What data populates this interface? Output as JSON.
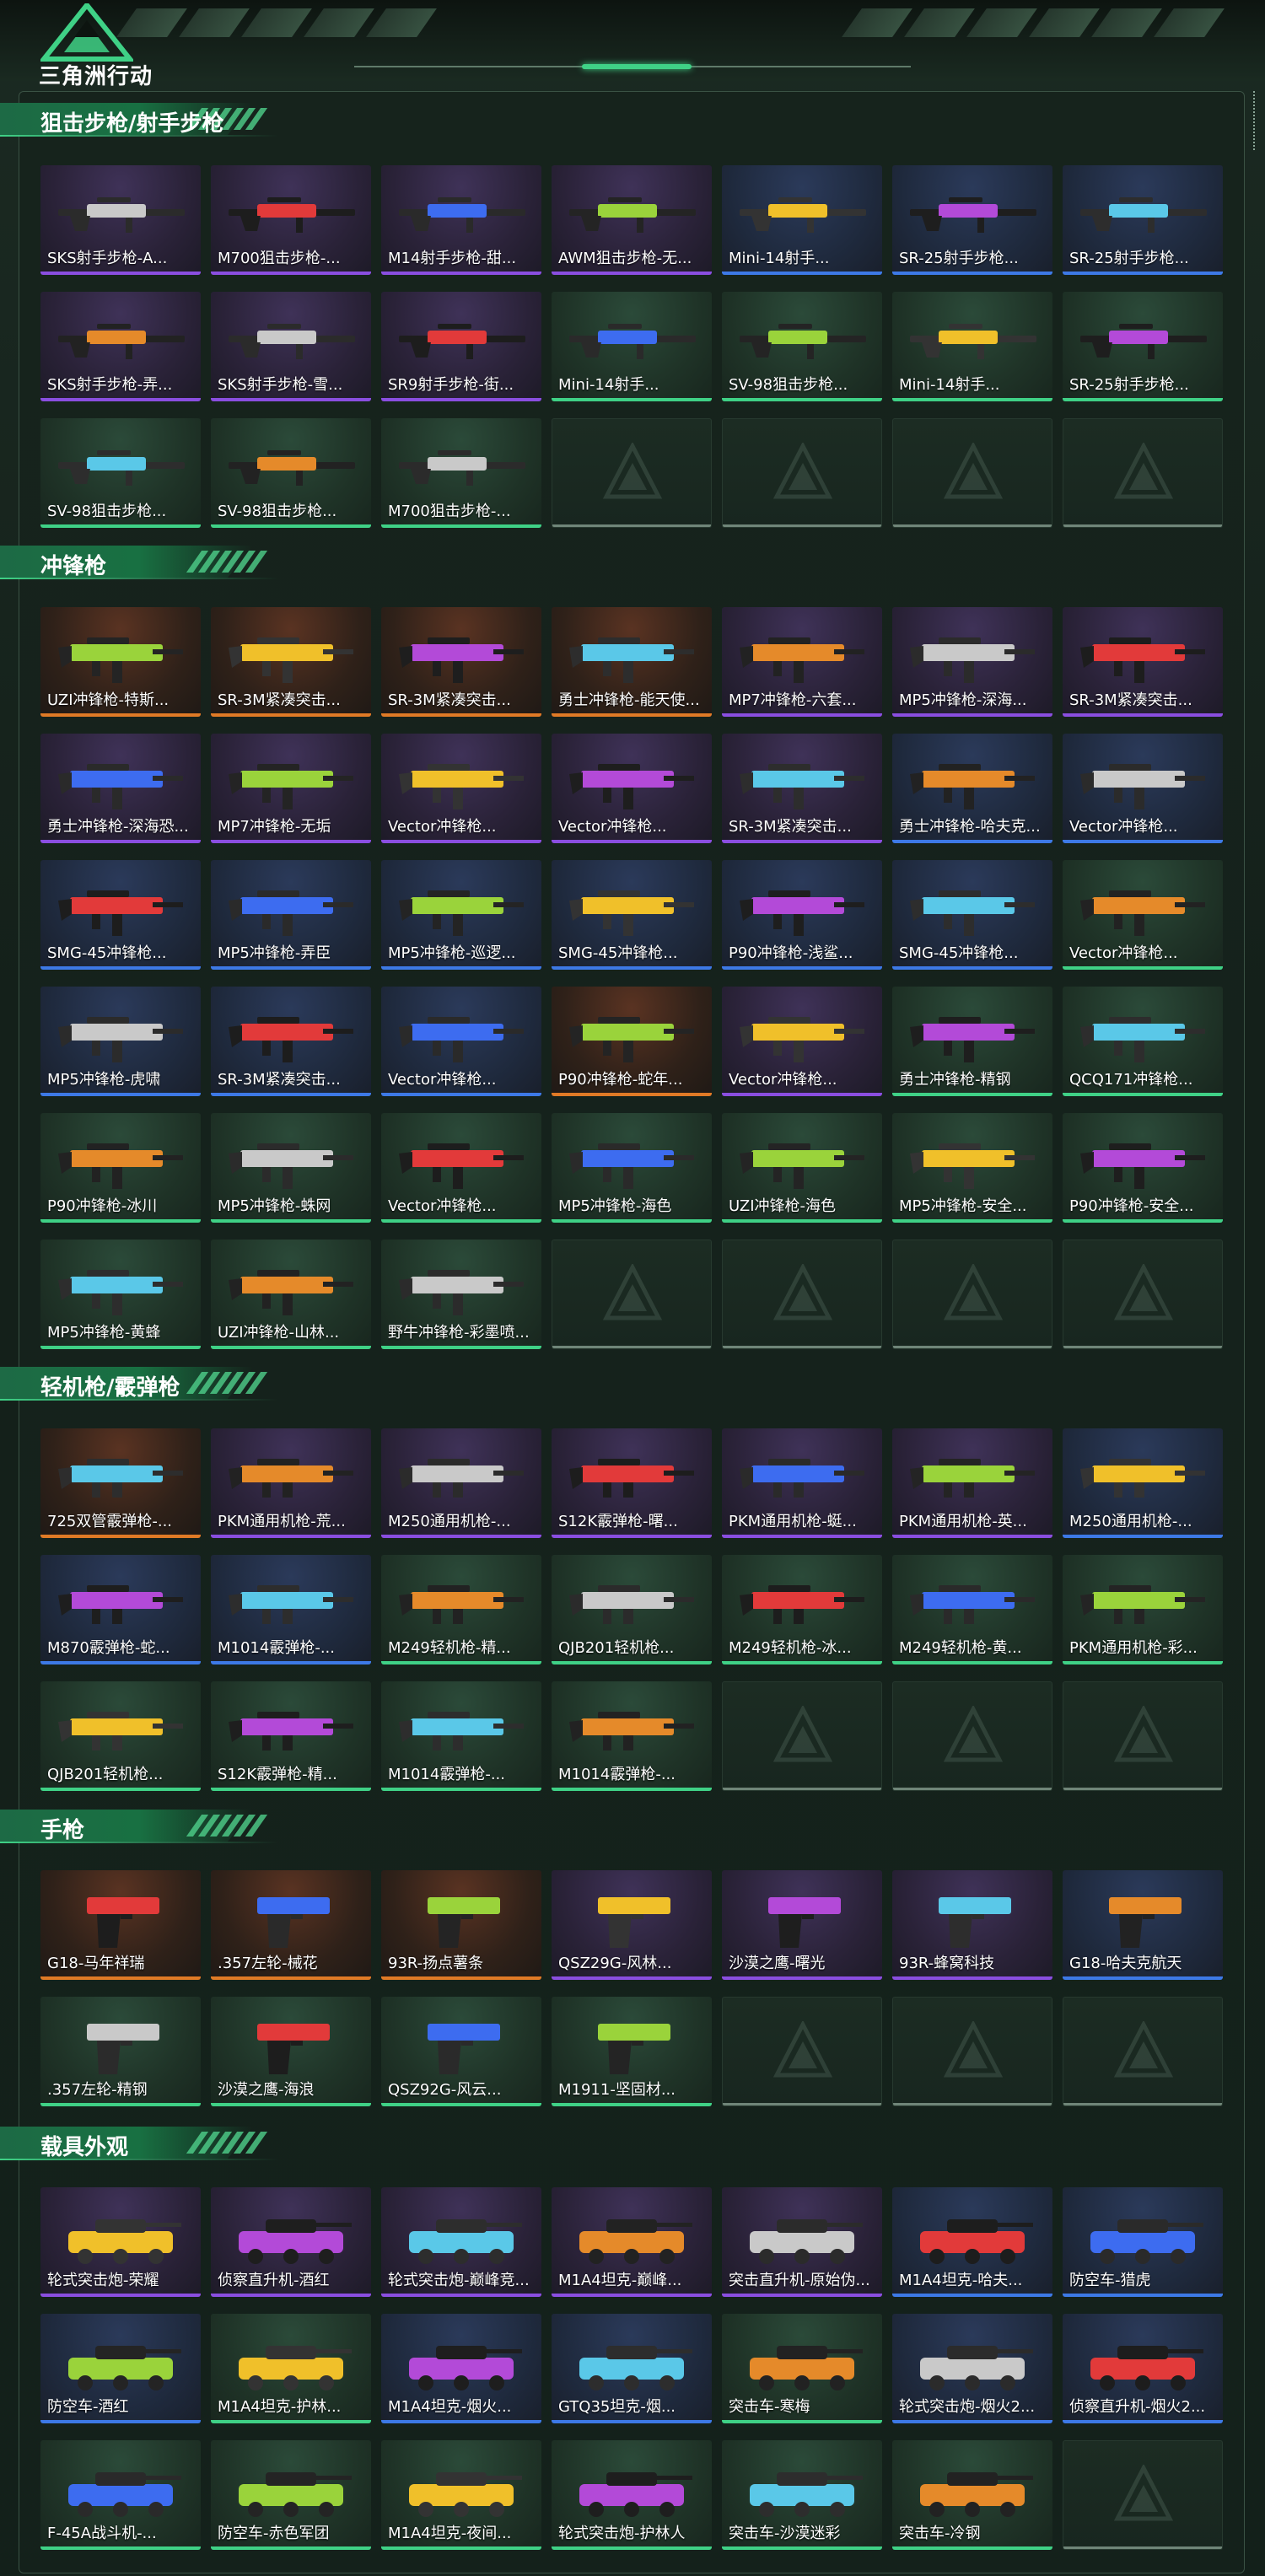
{
  "logo": {
    "text": "三角洲行动",
    "icon": "delta-logo-icon"
  },
  "colors": {
    "orange": "#e07a26",
    "purple": "#8a4ee0",
    "blue": "#3d79e6",
    "green": "#3fd186"
  },
  "sections": [
    {
      "id": "sniper",
      "title": "狙击步枪/射手步枪",
      "kind": "rifle",
      "items": [
        {
          "label": "SKS射手步枪-A...",
          "rarity": "purple"
        },
        {
          "label": "M700狙击步枪-...",
          "rarity": "purple"
        },
        {
          "label": "M14射手步枪-甜...",
          "rarity": "purple"
        },
        {
          "label": "AWM狙击步枪-无...",
          "rarity": "purple"
        },
        {
          "label": "Mini-14射手...",
          "rarity": "blue"
        },
        {
          "label": "SR-25射手步枪...",
          "rarity": "blue"
        },
        {
          "label": "SR-25射手步枪...",
          "rarity": "blue"
        },
        {
          "label": "SKS射手步枪-弄...",
          "rarity": "purple"
        },
        {
          "label": "SKS射手步枪-雪...",
          "rarity": "purple"
        },
        {
          "label": "SR9射手步枪-街...",
          "rarity": "purple"
        },
        {
          "label": "Mini-14射手...",
          "rarity": "green"
        },
        {
          "label": "SV-98狙击步枪...",
          "rarity": "green"
        },
        {
          "label": "Mini-14射手...",
          "rarity": "green"
        },
        {
          "label": "SR-25射手步枪...",
          "rarity": "green"
        },
        {
          "label": "SV-98狙击步枪...",
          "rarity": "green"
        },
        {
          "label": "SV-98狙击步枪...",
          "rarity": "green"
        },
        {
          "label": "M700狙击步枪-...",
          "rarity": "green"
        }
      ],
      "empty": 4
    },
    {
      "id": "smg",
      "title": "冲锋枪",
      "kind": "smg",
      "items": [
        {
          "label": "UZI冲锋枪-特斯...",
          "rarity": "orange"
        },
        {
          "label": "SR-3M紧凑突击...",
          "rarity": "orange"
        },
        {
          "label": "SR-3M紧凑突击...",
          "rarity": "orange"
        },
        {
          "label": "勇士冲锋枪-能天使...",
          "rarity": "orange"
        },
        {
          "label": "MP7冲锋枪-六套...",
          "rarity": "purple"
        },
        {
          "label": "MP5冲锋枪-深海...",
          "rarity": "purple"
        },
        {
          "label": "SR-3M紧凑突击...",
          "rarity": "purple"
        },
        {
          "label": "勇士冲锋枪-深海恐...",
          "rarity": "purple"
        },
        {
          "label": "MP7冲锋枪-无垢",
          "rarity": "purple"
        },
        {
          "label": "Vector冲锋枪...",
          "rarity": "purple"
        },
        {
          "label": "Vector冲锋枪...",
          "rarity": "purple"
        },
        {
          "label": "SR-3M紧凑突击...",
          "rarity": "purple"
        },
        {
          "label": "勇士冲锋枪-哈夫克...",
          "rarity": "blue"
        },
        {
          "label": "Vector冲锋枪...",
          "rarity": "blue"
        },
        {
          "label": "SMG-45冲锋枪...",
          "rarity": "blue"
        },
        {
          "label": "MP5冲锋枪-弄臣",
          "rarity": "blue"
        },
        {
          "label": "MP5冲锋枪-巡逻...",
          "rarity": "blue"
        },
        {
          "label": "SMG-45冲锋枪...",
          "rarity": "blue"
        },
        {
          "label": "P90冲锋枪-浅鲨...",
          "rarity": "blue"
        },
        {
          "label": "SMG-45冲锋枪...",
          "rarity": "blue"
        },
        {
          "label": "Vector冲锋枪...",
          "rarity": "green"
        },
        {
          "label": "MP5冲锋枪-虎啸",
          "rarity": "blue"
        },
        {
          "label": "SR-3M紧凑突击...",
          "rarity": "blue"
        },
        {
          "label": "Vector冲锋枪...",
          "rarity": "blue"
        },
        {
          "label": "P90冲锋枪-蛇年...",
          "rarity": "orange"
        },
        {
          "label": "Vector冲锋枪...",
          "rarity": "purple"
        },
        {
          "label": "勇士冲锋枪-精钢",
          "rarity": "green"
        },
        {
          "label": "QCQ171冲锋枪...",
          "rarity": "green"
        },
        {
          "label": "P90冲锋枪-冰川",
          "rarity": "green"
        },
        {
          "label": "MP5冲锋枪-蛛网",
          "rarity": "green"
        },
        {
          "label": "Vector冲锋枪...",
          "rarity": "green"
        },
        {
          "label": "MP5冲锋枪-海色",
          "rarity": "green"
        },
        {
          "label": "UZI冲锋枪-海色",
          "rarity": "green"
        },
        {
          "label": "MP5冲锋枪-安全...",
          "rarity": "green"
        },
        {
          "label": "P90冲锋枪-安全...",
          "rarity": "green"
        },
        {
          "label": "MP5冲锋枪-黄蜂",
          "rarity": "green"
        },
        {
          "label": "UZI冲锋枪-山林...",
          "rarity": "green"
        },
        {
          "label": "野牛冲锋枪-彩墨喷...",
          "rarity": "green"
        }
      ],
      "empty": 4
    },
    {
      "id": "lmg",
      "title": "轻机枪/霰弹枪",
      "kind": "lmg",
      "items": [
        {
          "label": "725双管霰弹枪-...",
          "rarity": "orange"
        },
        {
          "label": "PKM通用机枪-荒...",
          "rarity": "purple"
        },
        {
          "label": "M250通用机枪-...",
          "rarity": "purple"
        },
        {
          "label": "S12K霰弹枪-曙...",
          "rarity": "purple"
        },
        {
          "label": "PKM通用机枪-蜓...",
          "rarity": "purple"
        },
        {
          "label": "PKM通用机枪-英...",
          "rarity": "purple"
        },
        {
          "label": "M250通用机枪-...",
          "rarity": "blue"
        },
        {
          "label": "M870霰弹枪-蛇...",
          "rarity": "blue"
        },
        {
          "label": "M1014霰弹枪-...",
          "rarity": "blue"
        },
        {
          "label": "M249轻机枪-精...",
          "rarity": "green"
        },
        {
          "label": "QJB201轻机枪...",
          "rarity": "green"
        },
        {
          "label": "M249轻机枪-冰...",
          "rarity": "green"
        },
        {
          "label": "M249轻机枪-黄...",
          "rarity": "green"
        },
        {
          "label": "PKM通用机枪-彩...",
          "rarity": "green"
        },
        {
          "label": "QJB201轻机枪...",
          "rarity": "green"
        },
        {
          "label": "S12K霰弹枪-精...",
          "rarity": "green"
        },
        {
          "label": "M1014霰弹枪-...",
          "rarity": "green"
        },
        {
          "label": "M1014霰弹枪-...",
          "rarity": "green"
        }
      ],
      "empty": 3
    },
    {
      "id": "pistol",
      "title": "手枪",
      "kind": "pistol",
      "items": [
        {
          "label": "G18-马年祥瑞",
          "rarity": "orange"
        },
        {
          "label": ".357左轮-械花",
          "rarity": "orange"
        },
        {
          "label": "93R-扬点薯条",
          "rarity": "orange"
        },
        {
          "label": "QSZ29G-风林...",
          "rarity": "purple"
        },
        {
          "label": "沙漠之鹰-曙光",
          "rarity": "purple"
        },
        {
          "label": "93R-蜂窝科技",
          "rarity": "purple"
        },
        {
          "label": "G18-哈夫克航天",
          "rarity": "blue"
        },
        {
          "label": ".357左轮-精钢",
          "rarity": "green"
        },
        {
          "label": "沙漠之鹰-海浪",
          "rarity": "green"
        },
        {
          "label": "QSZ92G-风云...",
          "rarity": "green"
        },
        {
          "label": "M1911-坚固材...",
          "rarity": "green"
        }
      ],
      "empty": 3
    },
    {
      "id": "vehicle",
      "title": "载具外观",
      "kind": "vehicle",
      "items": [
        {
          "label": "轮式突击炮-荣耀",
          "rarity": "purple"
        },
        {
          "label": "侦察直升机-酒红",
          "rarity": "purple"
        },
        {
          "label": "轮式突击炮-巅峰竞...",
          "rarity": "purple"
        },
        {
          "label": "M1A4坦克-巅峰...",
          "rarity": "purple"
        },
        {
          "label": "突击直升机-原始伪...",
          "rarity": "purple"
        },
        {
          "label": "M1A4坦克-哈夫...",
          "rarity": "blue"
        },
        {
          "label": "防空车-猎虎",
          "rarity": "blue"
        },
        {
          "label": "防空车-酒红",
          "rarity": "blue"
        },
        {
          "label": "M1A4坦克-护林...",
          "rarity": "green"
        },
        {
          "label": "M1A4坦克-烟火...",
          "rarity": "blue"
        },
        {
          "label": "GTQ35坦克-烟...",
          "rarity": "blue"
        },
        {
          "label": "突击车-寒梅",
          "rarity": "green"
        },
        {
          "label": "轮式突击炮-烟火2...",
          "rarity": "blue"
        },
        {
          "label": "侦察直升机-烟火2...",
          "rarity": "blue"
        },
        {
          "label": "F-45A战斗机-...",
          "rarity": "green"
        },
        {
          "label": "防空车-赤色军团",
          "rarity": "green"
        },
        {
          "label": "M1A4坦克-夜间...",
          "rarity": "green"
        },
        {
          "label": "轮式突击炮-护林人",
          "rarity": "green"
        },
        {
          "label": "突击车-沙漠迷彩",
          "rarity": "green"
        },
        {
          "label": "突击车-冷钢",
          "rarity": "green"
        }
      ],
      "empty": 1
    }
  ]
}
